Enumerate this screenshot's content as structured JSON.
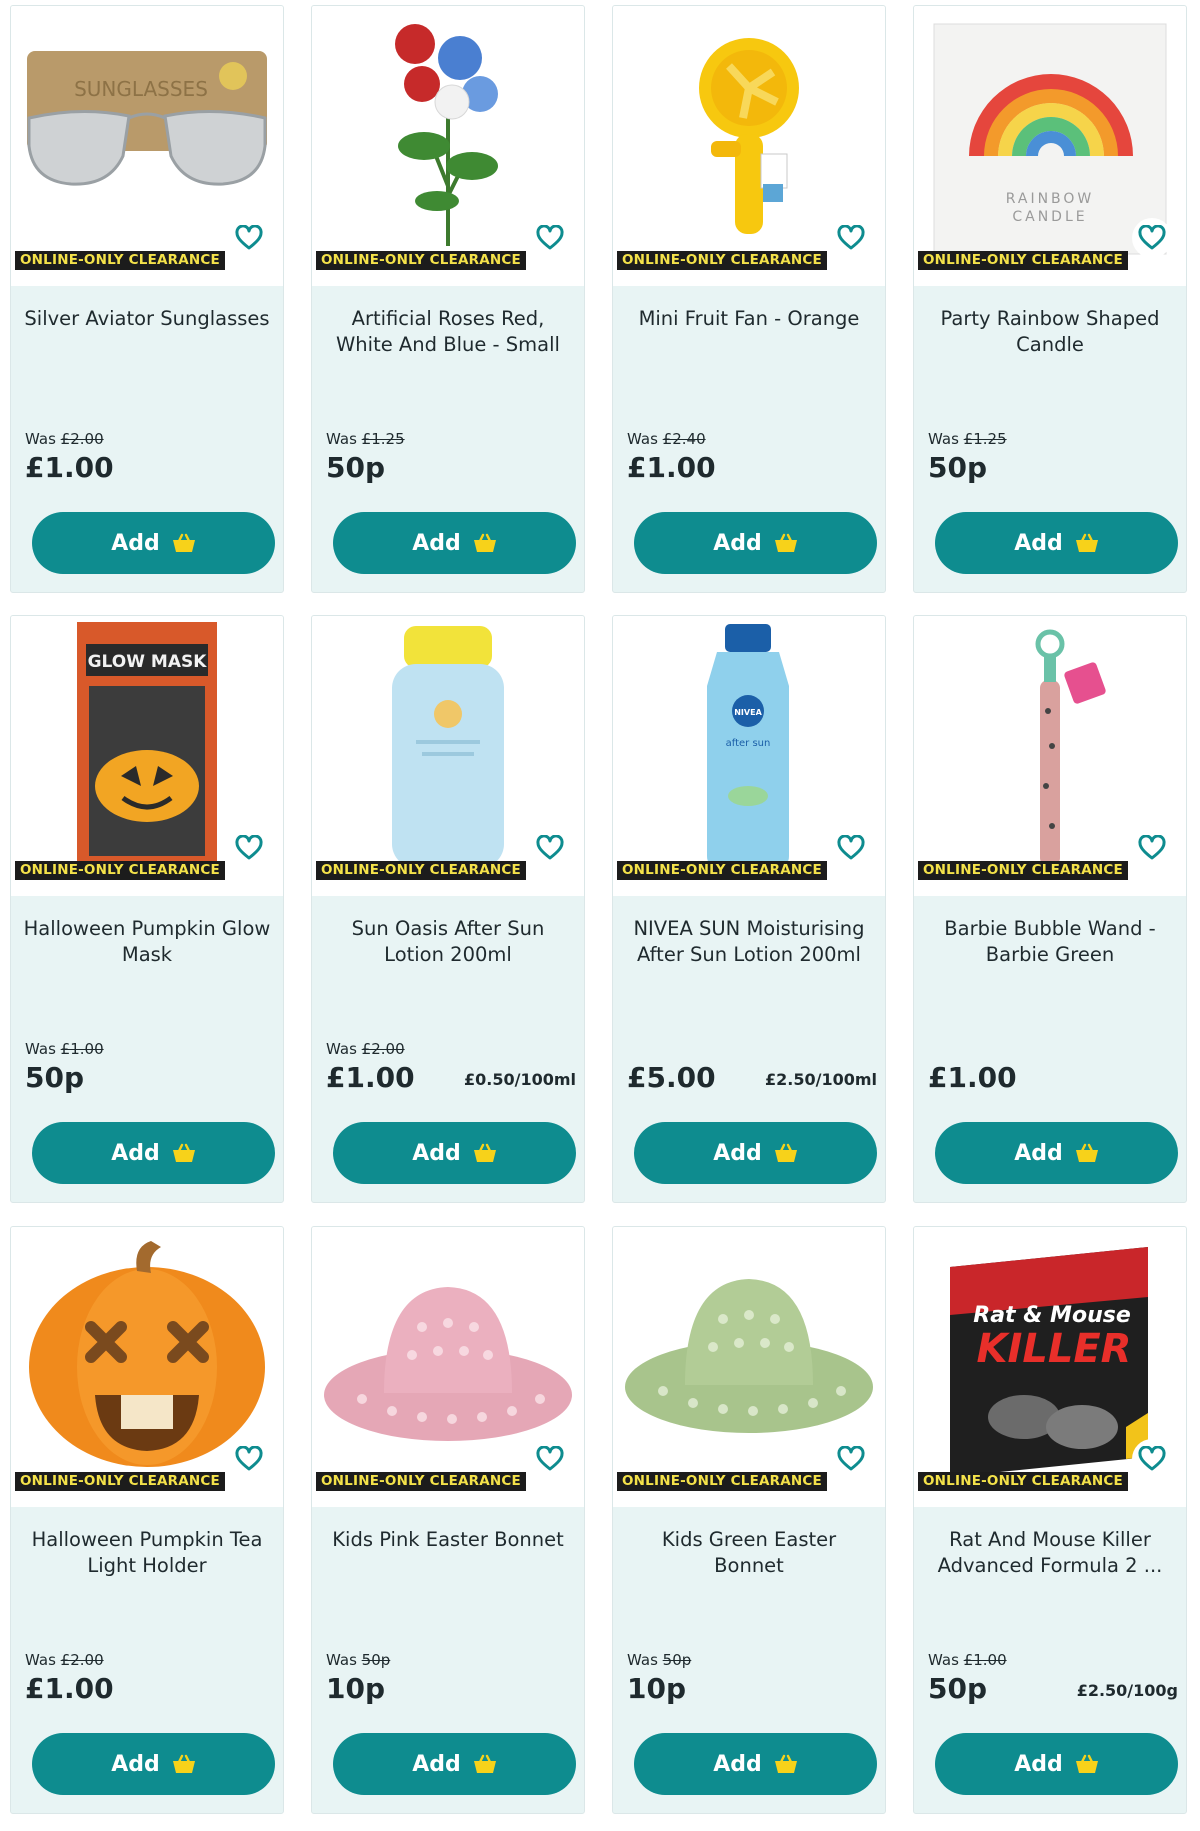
{
  "colors": {
    "accent": "#0e8c8f",
    "card_bg": "#e8f4f4",
    "badge_bg": "#1c1c1c",
    "badge_text": "#f4e24a",
    "basket_icon": "#f7d21a"
  },
  "products": [
    {
      "badge": "ONLINE-ONLY CLEARANCE",
      "title": "Silver Aviator Sunglasses",
      "was_label": "Was",
      "was_price": "£2.00",
      "price": "£1.00",
      "unit_price": "",
      "add_label": "Add",
      "image_icon": "sunglasses-icon"
    },
    {
      "badge": "ONLINE-ONLY CLEARANCE",
      "title": "Artificial Roses Red, White And Blue - Small",
      "was_label": "Was",
      "was_price": "£1.25",
      "price": "50p",
      "unit_price": "",
      "add_label": "Add",
      "image_icon": "roses-icon"
    },
    {
      "badge": "ONLINE-ONLY CLEARANCE",
      "title": "Mini Fruit Fan - Orange",
      "was_label": "Was",
      "was_price": "£2.40",
      "price": "£1.00",
      "unit_price": "",
      "add_label": "Add",
      "image_icon": "fan-icon"
    },
    {
      "badge": "ONLINE-ONLY CLEARANCE",
      "title": "Party Rainbow Shaped Candle",
      "was_label": "Was",
      "was_price": "£1.25",
      "price": "50p",
      "unit_price": "",
      "add_label": "Add",
      "image_icon": "rainbow-candle-icon",
      "image_text": [
        "RAINBOW",
        "CANDLE"
      ]
    },
    {
      "badge": "ONLINE-ONLY CLEARANCE",
      "title": "Halloween Pumpkin Glow Mask",
      "was_label": "Was",
      "was_price": "£1.00",
      "price": "50p",
      "unit_price": "",
      "add_label": "Add",
      "image_icon": "glow-mask-icon",
      "image_text": [
        "GLOW MASK"
      ]
    },
    {
      "badge": "ONLINE-ONLY CLEARANCE",
      "title": "Sun Oasis After Sun Lotion 200ml",
      "was_label": "Was",
      "was_price": "£2.00",
      "price": "£1.00",
      "unit_price": "£0.50/100ml",
      "add_label": "Add",
      "image_icon": "lotion-bottle-icon"
    },
    {
      "badge": "ONLINE-ONLY CLEARANCE",
      "title": "NIVEA SUN Moisturising After Sun Lotion 200ml",
      "was_label": "",
      "was_price": "",
      "price": "£5.00",
      "unit_price": "£2.50/100ml",
      "add_label": "Add",
      "image_icon": "nivea-bottle-icon",
      "image_text": [
        "NIVEA",
        "after sun"
      ]
    },
    {
      "badge": "ONLINE-ONLY CLEARANCE",
      "title": "Barbie Bubble Wand - Barbie Green",
      "was_label": "",
      "was_price": "",
      "price": "£1.00",
      "unit_price": "",
      "add_label": "Add",
      "image_icon": "bubble-wand-icon"
    },
    {
      "badge": "ONLINE-ONLY CLEARANCE",
      "title": "Halloween Pumpkin Tea Light Holder",
      "was_label": "Was",
      "was_price": "£2.00",
      "price": "£1.00",
      "unit_price": "",
      "add_label": "Add",
      "image_icon": "pumpkin-icon"
    },
    {
      "badge": "ONLINE-ONLY CLEARANCE",
      "title": "Kids Pink Easter Bonnet",
      "was_label": "Was",
      "was_price": "50p",
      "price": "10p",
      "unit_price": "",
      "add_label": "Add",
      "image_icon": "pink-bonnet-icon"
    },
    {
      "badge": "ONLINE-ONLY CLEARANCE",
      "title": "Kids Green Easter Bonnet",
      "was_label": "Was",
      "was_price": "50p",
      "price": "10p",
      "unit_price": "",
      "add_label": "Add",
      "image_icon": "green-bonnet-icon"
    },
    {
      "badge": "ONLINE-ONLY CLEARANCE",
      "title": "Rat And Mouse Killer Advanced Formula 2 ...",
      "was_label": "Was",
      "was_price": "£1.00",
      "price": "50p",
      "unit_price": "£2.50/100g",
      "add_label": "Add",
      "image_icon": "rat-killer-box-icon",
      "image_text": [
        "Rat & Mouse",
        "KILLER"
      ]
    }
  ]
}
